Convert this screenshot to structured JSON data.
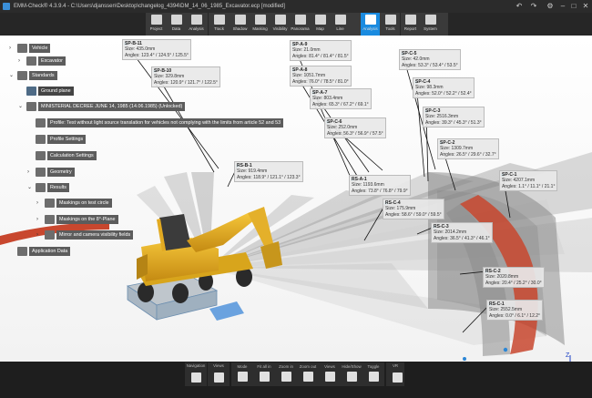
{
  "window": {
    "title": "EMM-Check® 4.3.9.4 - C:\\Users\\djanssen\\Desktop\\changelog_4394\\DM_14_06_1985_Excavator.ecp [modified]",
    "undo_icon": "undo-icon",
    "redo_icon": "redo-icon",
    "settings_icon": "gear-icon",
    "minimize_glyph": "–",
    "maximize_glyph": "□",
    "close_glyph": "✕"
  },
  "ribbon": {
    "buttons": [
      {
        "label": "Project",
        "icon": "project-icon"
      },
      {
        "label": "Data",
        "icon": "data-icon"
      },
      {
        "label": "Analysis",
        "icon": "analysis-icon"
      },
      {
        "label": "Track",
        "icon": "track-icon"
      },
      {
        "label": "Shadow",
        "icon": "shadow-icon"
      },
      {
        "label": "Masking",
        "icon": "masking-icon"
      },
      {
        "label": "Visibility",
        "icon": "visibility-icon"
      },
      {
        "label": "Panorama",
        "icon": "panorama-icon"
      },
      {
        "label": "Map",
        "icon": "map-icon"
      },
      {
        "label": "Line",
        "icon": "line-icon"
      },
      {
        "label": "Analysis",
        "icon": "analysis-run-icon"
      },
      {
        "label": "Tools",
        "icon": "tools-icon"
      },
      {
        "label": "Report",
        "icon": "report-icon"
      },
      {
        "label": "System",
        "icon": "system-icon"
      }
    ],
    "active_index": 10,
    "accent_color": "#1a8be0"
  },
  "tree": [
    {
      "label": "Vehicle",
      "indent": 0,
      "chevron": ">",
      "icon": "vehicle-icon"
    },
    {
      "label": "Excavator",
      "indent": 1,
      "chevron": ">",
      "icon": "excavator-icon"
    },
    {
      "label": "Standards",
      "indent": 0,
      "chevron": "v",
      "icon": "standards-icon"
    },
    {
      "label": "Ground plane",
      "indent": 1,
      "chevron": "",
      "icon": "ground-plane-icon",
      "selected": true
    },
    {
      "label": "MINISTERIAL DECREE JUNE 14, 1985 (14.06.1985) (Unlocked)",
      "indent": 1,
      "chevron": "v",
      "icon": "decree-icon"
    },
    {
      "label": "Profile: Test without light source translation for vehicles not complying with the limits from article 52 and 53",
      "indent": 2,
      "chevron": "",
      "icon": "profile-icon"
    },
    {
      "label": "Profile Settings",
      "indent": 2,
      "chevron": "",
      "icon": "profile-settings-icon"
    },
    {
      "label": "Calculation Settings",
      "indent": 2,
      "chevron": "",
      "icon": "calculation-settings-icon"
    },
    {
      "label": "Geometry",
      "indent": 2,
      "chevron": ">",
      "icon": "geometry-icon"
    },
    {
      "label": "Results",
      "indent": 2,
      "chevron": "v",
      "icon": "results-icon"
    },
    {
      "label": "Maskings on test circle",
      "indent": 3,
      "chevron": ">",
      "icon": "maskings-circle-icon"
    },
    {
      "label": "Maskings on the 8°-Plane",
      "indent": 3,
      "chevron": ">",
      "icon": "maskings-plane-icon"
    },
    {
      "label": "Mirror and camera visibility fields",
      "indent": 3,
      "chevron": ">",
      "icon": "mirror-camera-icon"
    },
    {
      "label": "Application Data",
      "indent": 0,
      "chevron": "",
      "icon": "application-data-icon"
    }
  ],
  "callouts": [
    {
      "name": "SP-B-11",
      "size": "Size: 435.0mm",
      "angles": "Angles: 123.4° / 124.5° / 125.5°"
    },
    {
      "name": "SP-B-10",
      "size": "Size: 329.8mm",
      "angles": "Angles: 120.9° / 121.7° / 122.5°"
    },
    {
      "name": "SP-A-9",
      "size": "Size: 21.0mm",
      "angles": "Angles: 81.4° / 81.4° / 81.5°"
    },
    {
      "name": "SP-A-8",
      "size": "Size: 1051.7mm",
      "angles": "Angles: 76.0° / 78.5° / 81.0°"
    },
    {
      "name": "SP-A-7",
      "size": "Size: 803.4mm",
      "angles": "Angles: 65.3° / 67.2° / 69.1°"
    },
    {
      "name": "SP-C-6",
      "size": "Size: 252.0mm",
      "angles": "Angles: 56.3° / 56.9° / 57.5°"
    },
    {
      "name": "SP-C-5",
      "size": "Size: 42.0mm",
      "angles": "Angles: 53.3° / 53.4° / 53.5°"
    },
    {
      "name": "SP-C-4",
      "size": "Size: 98.3mm",
      "angles": "Angles: 52.0° / 52.2° / 52.4°"
    },
    {
      "name": "SP-C-3",
      "size": "Size: 2516.3mm",
      "angles": "Angles: 39.3° / 45.3° / 51.3°"
    },
    {
      "name": "SP-C-2",
      "size": "Size: 1309.7mm",
      "angles": "Angles: 26.5° / 29.6° / 32.7°"
    },
    {
      "name": "SP-C-1",
      "size": "Size: 4207.1mm",
      "angles": "Angles: 1.1° / 11.1° / 21.1°"
    },
    {
      "name": "RS-B-1",
      "size": "Size: 919.4mm",
      "angles": "Angles: 118.9° / 121.1° / 123.3°"
    },
    {
      "name": "RS-A-1",
      "size": "Size: 1193.6mm",
      "angles": "Angles: 73.8° / 76.8° / 79.9°"
    },
    {
      "name": "RS-C-4",
      "size": "Size: 175.9mm",
      "angles": "Angles: 58.6° / 59.0° / 59.5°"
    },
    {
      "name": "RS-C-3",
      "size": "Size: 2014.2mm",
      "angles": "Angles: 36.5° / 41.3° / 46.1°"
    },
    {
      "name": "RS-C-2",
      "size": "Size: 2020.8mm",
      "angles": "Angles: 20.4° / 25.2° / 30.0°"
    },
    {
      "name": "RS-C-1",
      "size": "Size: 2552.5mm",
      "angles": "Angles: 0.0° / 6.1° / 12.2°"
    }
  ],
  "bottom_toolbar": {
    "groups": [
      {
        "label": "Navigation",
        "buttons": [
          {
            "label": "",
            "icon": "grid-icon"
          }
        ]
      },
      {
        "label": "Views",
        "buttons": [
          {
            "label": "",
            "icon": "fullscreen-icon"
          }
        ]
      },
      {
        "label": "",
        "buttons": [
          {
            "label": "Mode",
            "icon": "mode-icon"
          },
          {
            "label": "Fit all in",
            "icon": "fit-all-icon"
          },
          {
            "label": "Zoom in",
            "icon": "zoom-in-icon"
          },
          {
            "label": "Zoom out",
            "icon": "zoom-out-icon"
          },
          {
            "label": "Views",
            "icon": "views-icon"
          },
          {
            "label": "Hide/Show",
            "icon": "hide-show-icon"
          },
          {
            "label": "Toggle",
            "icon": "toggle-icon"
          }
        ]
      },
      {
        "label": "VR",
        "buttons": [
          {
            "label": "",
            "icon": "vr-icon"
          }
        ]
      }
    ]
  },
  "axes": {
    "x": "X",
    "y": "Y",
    "z": "Z"
  },
  "colors": {
    "accent": "#1a8be0",
    "ring": "#c8472e",
    "machine": "#e8b020"
  }
}
